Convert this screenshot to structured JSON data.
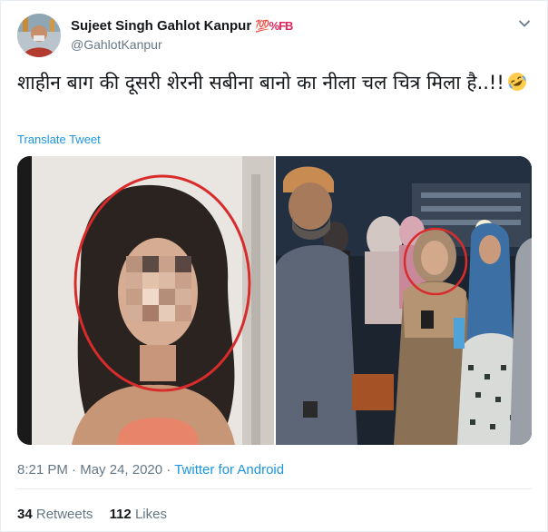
{
  "author": {
    "name": "Sujeet Singh Gahlot Kanpur",
    "badge": "💯%FB",
    "handle": "@GahlotKanpur"
  },
  "tweet": {
    "text": "शाहीन बाग की दूसरी शेरनी सबीना बानो का नीला चल चित्र मिला है..!!",
    "emoji": "rolling-on-floor-laughing-emoji",
    "translate_label": "Translate Tweet"
  },
  "media": {
    "left_photo": "blurred-woman-portrait-circled",
    "right_photo": "crowd-with-man-in-cap-and-circled-woman"
  },
  "meta": {
    "time": "8:21 PM",
    "separator1": "·",
    "date": "May 24, 2020",
    "separator2": "·",
    "source": "Twitter for Android"
  },
  "stats": {
    "retweets_count": "34",
    "retweets_label": "Retweets",
    "likes_count": "112",
    "likes_label": "Likes"
  },
  "colors": {
    "link": "#1b95e0",
    "secondary": "#657786",
    "circle": "#d82c2c"
  }
}
